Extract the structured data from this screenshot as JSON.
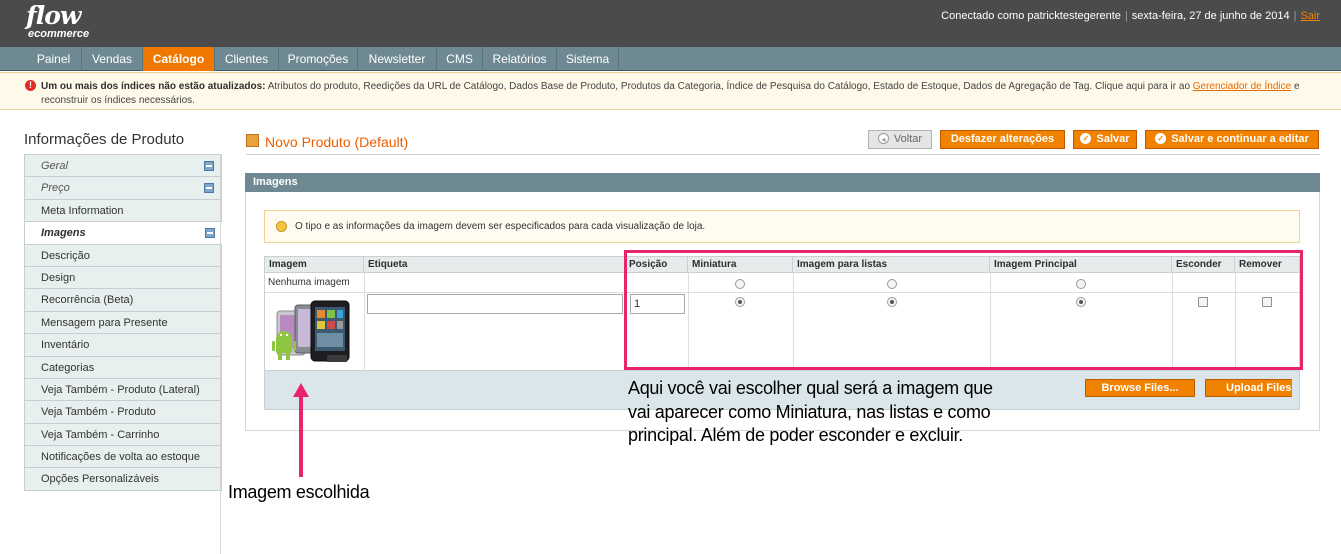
{
  "header": {
    "logo_main": "flow",
    "logo_sub": "ecommerce",
    "connected": "Conectado como patricktestegerente",
    "date": "sexta-feira, 27 de junho de 2014",
    "logout": "Sair"
  },
  "nav": {
    "items": [
      {
        "label": "Painel"
      },
      {
        "label": "Vendas"
      },
      {
        "label": "Catálogo"
      },
      {
        "label": "Clientes"
      },
      {
        "label": "Promoções"
      },
      {
        "label": "Newsletter"
      },
      {
        "label": "CMS"
      },
      {
        "label": "Relatórios"
      },
      {
        "label": "Sistema"
      }
    ],
    "active": "Catálogo"
  },
  "notice": {
    "bold": "Um ou mais dos índices não estão atualizados:",
    "text": " Atributos do produto, Reedições da URL de Catálogo, Dados Base de Produto, Produtos da Categoria, Índice de Pesquisa do Catálogo, Estado de Estoque, Dados de Agregação de Tag. Clique aqui para ir ao ",
    "link": "Gerenciador de Índice",
    "tail": " e reconstruir os índices necessários."
  },
  "sidebar": {
    "title": "Informações de Produto",
    "items": [
      {
        "label": "Geral"
      },
      {
        "label": "Preço"
      },
      {
        "label": "Meta Information"
      },
      {
        "label": "Imagens"
      },
      {
        "label": "Descrição"
      },
      {
        "label": "Design"
      },
      {
        "label": "Recorrência (Beta)"
      },
      {
        "label": "Mensagem para Presente"
      },
      {
        "label": "Inventário"
      },
      {
        "label": "Categorias"
      },
      {
        "label": "Veja Também - Produto (Lateral)"
      },
      {
        "label": "Veja Também - Produto"
      },
      {
        "label": "Veja Também - Carrinho"
      },
      {
        "label": "Notificações de volta ao estoque"
      },
      {
        "label": "Opções Personalizáveis"
      }
    ],
    "active": "Imagens"
  },
  "page": {
    "title": "Novo Produto (Default)",
    "buttons": {
      "back": "Voltar",
      "reset": "Desfazer alterações",
      "save": "Salvar",
      "save_continue": "Salvar e continuar a editar"
    }
  },
  "images_section": {
    "title": "Imagens",
    "hint": "O tipo e as informações da imagem devem ser especificados para cada visualização de loja.",
    "columns": [
      "Imagem",
      "Etiqueta",
      "Posição",
      "Miniatura",
      "Imagem para listas",
      "Imagem Principal",
      "Esconder",
      "Remover"
    ],
    "no_image_label": "Nenhuma imagem",
    "row": {
      "label_value": "",
      "position": "1",
      "thumbnail": true,
      "small_image": true,
      "main_image": true,
      "hide": false,
      "remove": false
    },
    "browse_button": "Browse Files...",
    "upload_button": "Upload Files"
  },
  "annotations": {
    "right_line1": "Aqui você vai escolher qual será a imagem que",
    "right_line2": "vai aparecer como Miniatura, nas listas e como",
    "right_line3": "principal. Além de poder esconder e excluir.",
    "left": "Imagem escolhida"
  },
  "colors": {
    "accent": "#f18200",
    "nav": "#6f8992",
    "header": "#4a4b4c",
    "annotation": "#e8246d"
  }
}
